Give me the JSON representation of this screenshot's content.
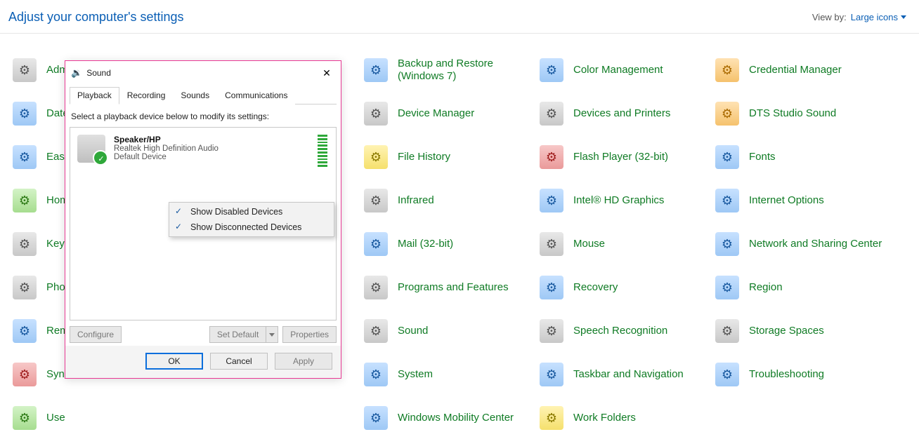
{
  "header": {
    "title": "Adjust your computer's settings",
    "viewby_label": "View by:",
    "viewby_value": "Large icons"
  },
  "items": [
    {
      "label": "Adm",
      "cls": "ic-gray"
    },
    {
      "label": "",
      "cls": "ic-gray"
    },
    {
      "label": "Backup and Restore (Windows 7)",
      "cls": "ic-blue"
    },
    {
      "label": "Color Management",
      "cls": "ic-blue"
    },
    {
      "label": "Credential Manager",
      "cls": "ic-orange"
    },
    {
      "label": "Date",
      "cls": "ic-blue"
    },
    {
      "label": "",
      "cls": "ic-blue"
    },
    {
      "label": "Device Manager",
      "cls": "ic-gray"
    },
    {
      "label": "Devices and Printers",
      "cls": "ic-gray"
    },
    {
      "label": "DTS Studio Sound",
      "cls": "ic-orange"
    },
    {
      "label": "Ease",
      "cls": "ic-blue"
    },
    {
      "label": "",
      "cls": "ic-blue"
    },
    {
      "label": "File History",
      "cls": "ic-yellow"
    },
    {
      "label": "Flash Player (32-bit)",
      "cls": "ic-red"
    },
    {
      "label": "Fonts",
      "cls": "ic-blue"
    },
    {
      "label": "Hom",
      "cls": "ic-green"
    },
    {
      "label": "",
      "cls": "ic-green"
    },
    {
      "label": "Infrared",
      "cls": "ic-gray"
    },
    {
      "label": "Intel® HD Graphics",
      "cls": "ic-blue"
    },
    {
      "label": "Internet Options",
      "cls": "ic-blue"
    },
    {
      "label": "Keyb",
      "cls": "ic-gray"
    },
    {
      "label": "",
      "cls": "ic-gray"
    },
    {
      "label": "Mail (32-bit)",
      "cls": "ic-blue"
    },
    {
      "label": "Mouse",
      "cls": "ic-gray"
    },
    {
      "label": "Network and Sharing Center",
      "cls": "ic-blue"
    },
    {
      "label": "Pho",
      "cls": "ic-gray"
    },
    {
      "label": "",
      "cls": "ic-gray"
    },
    {
      "label": "Programs and Features",
      "cls": "ic-gray"
    },
    {
      "label": "Recovery",
      "cls": "ic-blue"
    },
    {
      "label": "Region",
      "cls": "ic-blue"
    },
    {
      "label": "Rem Con",
      "cls": "ic-blue"
    },
    {
      "label": "",
      "cls": "ic-blue"
    },
    {
      "label": "Sound",
      "cls": "ic-gray"
    },
    {
      "label": "Speech Recognition",
      "cls": "ic-gray"
    },
    {
      "label": "Storage Spaces",
      "cls": "ic-gray"
    },
    {
      "label": "Syn",
      "cls": "ic-red"
    },
    {
      "label": "",
      "cls": "ic-red"
    },
    {
      "label": "System",
      "cls": "ic-blue"
    },
    {
      "label": "Taskbar and Navigation",
      "cls": "ic-blue"
    },
    {
      "label": "Troubleshooting",
      "cls": "ic-blue"
    },
    {
      "label": "Use",
      "cls": "ic-green"
    },
    {
      "label": "",
      "cls": "ic-green"
    },
    {
      "label": "Windows Mobility Center",
      "cls": "ic-blue"
    },
    {
      "label": "Work Folders",
      "cls": "ic-yellow"
    },
    {
      "label": "",
      "cls": ""
    }
  ],
  "dialog": {
    "title": "Sound",
    "tabs": [
      "Playback",
      "Recording",
      "Sounds",
      "Communications"
    ],
    "instruction": "Select a playback device below to modify its settings:",
    "device": {
      "name": "Speaker/HP",
      "driver": "Realtek High Definition Audio",
      "status": "Default Device"
    },
    "context_menu": [
      "Show Disabled Devices",
      "Show Disconnected Devices"
    ],
    "buttons": {
      "configure": "Configure",
      "setdefault": "Set Default",
      "properties": "Properties",
      "ok": "OK",
      "cancel": "Cancel",
      "apply": "Apply"
    }
  }
}
